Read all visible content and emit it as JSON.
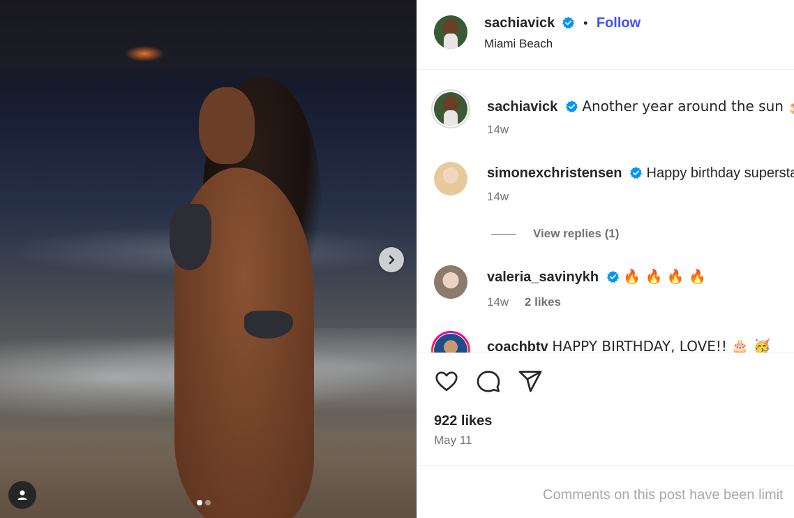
{
  "post": {
    "author": "sachiavick",
    "location": "Miami Beach",
    "follow_label": "Follow",
    "separator": "•"
  },
  "media": {
    "carousel_count": 2,
    "current_index": 1
  },
  "comments": [
    {
      "username": "sachiavick",
      "text": "Another year around the sun 🎂 🎉",
      "time": "14w",
      "likes": ""
    },
    {
      "username": "simonexchristensen",
      "text": "Happy birthday supersta",
      "time": "14w",
      "likes": ""
    },
    {
      "username": "valeria_savinykh",
      "text": "🔥 🔥 🔥 🔥",
      "time": "14w",
      "likes": "2 likes"
    },
    {
      "username": "coachbtv",
      "text": "HAPPY BIRTHDAY, LOVE!! 🎂 🥳",
      "time": "",
      "likes": ""
    }
  ],
  "view_replies": "View replies (1)",
  "likes_count": "922 likes",
  "post_date": "May 11",
  "comments_disabled_note": "Comments on this post have been limit",
  "colors": {
    "follow": "#4150f7",
    "verified": "#0095f6",
    "muted": "#737373"
  },
  "icons": [
    "like-icon",
    "comment-icon",
    "share-icon",
    "verified-icon",
    "chevron-right-icon",
    "user-tag-icon"
  ]
}
